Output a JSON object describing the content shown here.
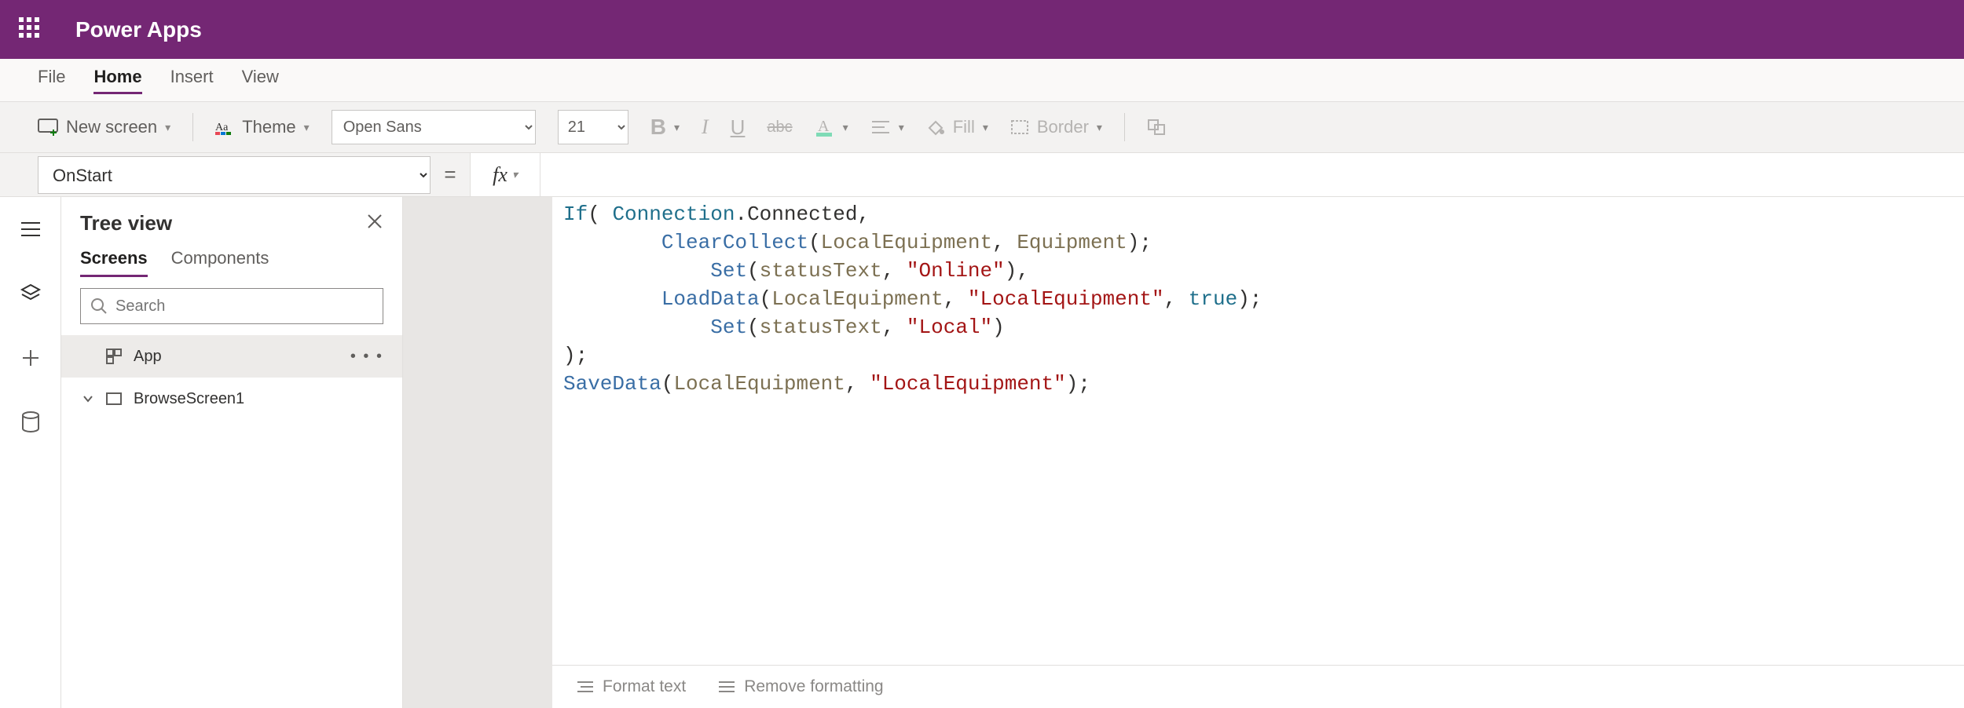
{
  "brand": {
    "title": "Power Apps"
  },
  "menu": {
    "items": [
      "File",
      "Home",
      "Insert",
      "View"
    ],
    "active_index": 1
  },
  "ribbon": {
    "new_screen": "New screen",
    "theme": "Theme",
    "font_name": "Open Sans",
    "font_size": "21",
    "fill_label": "Fill",
    "border_label": "Border"
  },
  "formula": {
    "property": "OnStart",
    "fx_label": "fx"
  },
  "code": {
    "line1_if": "If",
    "line1_open": "( ",
    "line1_conn": "Connection",
    "line1_dot": ".",
    "line1_connected": "Connected",
    "line1_comma": ",",
    "line2_indent": "        ",
    "line2_fn": "ClearCollect",
    "line2_rest_a": "(",
    "line2_id1": "LocalEquipment",
    "line2_comma": ", ",
    "line2_id2": "Equipment",
    "line2_close": ");",
    "line3_indent": "            ",
    "line3_fn": "Set",
    "line3_open": "(",
    "line3_id": "statusText",
    "line3_comma": ", ",
    "line3_str": "\"Online\"",
    "line3_close": "),",
    "line4_indent": "        ",
    "line4_fn": "LoadData",
    "line4_open": "(",
    "line4_id": "LocalEquipment",
    "line4_comma1": ", ",
    "line4_str": "\"LocalEquipment\"",
    "line4_comma2": ", ",
    "line4_true": "true",
    "line4_close": ");",
    "line5_indent": "            ",
    "line5_fn": "Set",
    "line5_open": "(",
    "line5_id": "statusText",
    "line5_comma": ", ",
    "line5_str": "\"Local\"",
    "line5_close": ")",
    "line6": ");",
    "line7_fn": "SaveData",
    "line7_open": "(",
    "line7_id": "LocalEquipment",
    "line7_comma": ", ",
    "line7_str": "\"LocalEquipment\"",
    "line7_close": ");"
  },
  "tree": {
    "title": "Tree view",
    "tabs": [
      "Screens",
      "Components"
    ],
    "active_tab": 0,
    "search_placeholder": "Search",
    "items": [
      {
        "label": "App",
        "selected": true,
        "icon": "grid"
      },
      {
        "label": "BrowseScreen1",
        "selected": false,
        "icon": "screen",
        "expandable": true
      }
    ]
  },
  "editor_footer": {
    "format": "Format text",
    "remove": "Remove formatting"
  }
}
